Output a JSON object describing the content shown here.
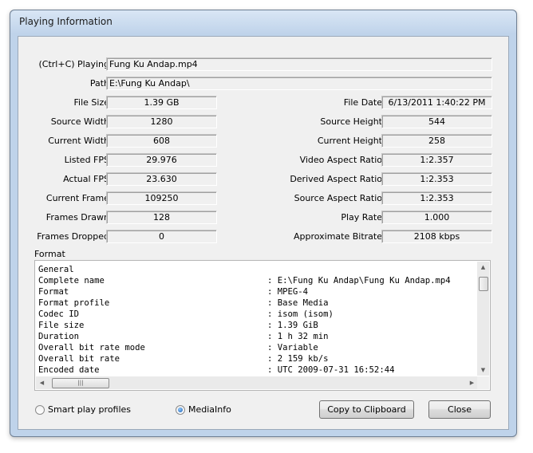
{
  "window": {
    "title": "Playing Information"
  },
  "playing": {
    "label": "(Ctrl+C) Playing",
    "value": "Fung Ku Andap.mp4"
  },
  "path": {
    "label": "Path",
    "value": "E:\\Fung Ku Andap\\"
  },
  "left_fields": [
    {
      "label": "File Size",
      "value": "1.39 GB"
    },
    {
      "label": "Source Width",
      "value": "1280"
    },
    {
      "label": "Current Width",
      "value": "608"
    },
    {
      "label": "Listed FPS",
      "value": "29.976"
    },
    {
      "label": "Actual FPS",
      "value": "23.630"
    },
    {
      "label": "Current Frame",
      "value": "109250"
    },
    {
      "label": "Frames Drawn",
      "value": "128"
    },
    {
      "label": "Frames Dropped",
      "value": "0"
    }
  ],
  "right_fields": [
    {
      "label": "File Date",
      "value": "6/13/2011 1:40:22 PM"
    },
    {
      "label": "Source Height",
      "value": "544"
    },
    {
      "label": "Current Height",
      "value": "258"
    },
    {
      "label": "Video Aspect Ratio",
      "value": "1:2.357"
    },
    {
      "label": "Derived Aspect Ratio",
      "value": "1:2.353"
    },
    {
      "label": "Source Aspect Ratio",
      "value": "1:2.353"
    },
    {
      "label": "Play Rate",
      "value": "1.000"
    },
    {
      "label": "Approximate Bitrate",
      "value": "2108 kbps"
    }
  ],
  "format": {
    "label": "Format",
    "section": "General",
    "rows": [
      {
        "key": "Complete name",
        "value": ": E:\\Fung Ku Andap\\Fung Ku Andap.mp4"
      },
      {
        "key": "Format",
        "value": ": MPEG-4"
      },
      {
        "key": "Format profile",
        "value": ": Base Media"
      },
      {
        "key": "Codec ID",
        "value": ": isom (isom)"
      },
      {
        "key": "File size",
        "value": ": 1.39 GiB"
      },
      {
        "key": "Duration",
        "value": ": 1 h 32 min"
      },
      {
        "key": "Overall bit rate mode",
        "value": ": Variable"
      },
      {
        "key": "Overall bit rate",
        "value": ": 2 159 kb/s"
      },
      {
        "key": "Encoded date",
        "value": ": UTC 2009-07-31 16:52:44"
      }
    ]
  },
  "options": {
    "smart_play_profiles": {
      "label": "Smart play profiles",
      "selected": false
    },
    "mediainfo": {
      "label": "MediaInfo",
      "selected": true
    }
  },
  "buttons": {
    "copy": "Copy to Clipboard",
    "close": "Close"
  }
}
